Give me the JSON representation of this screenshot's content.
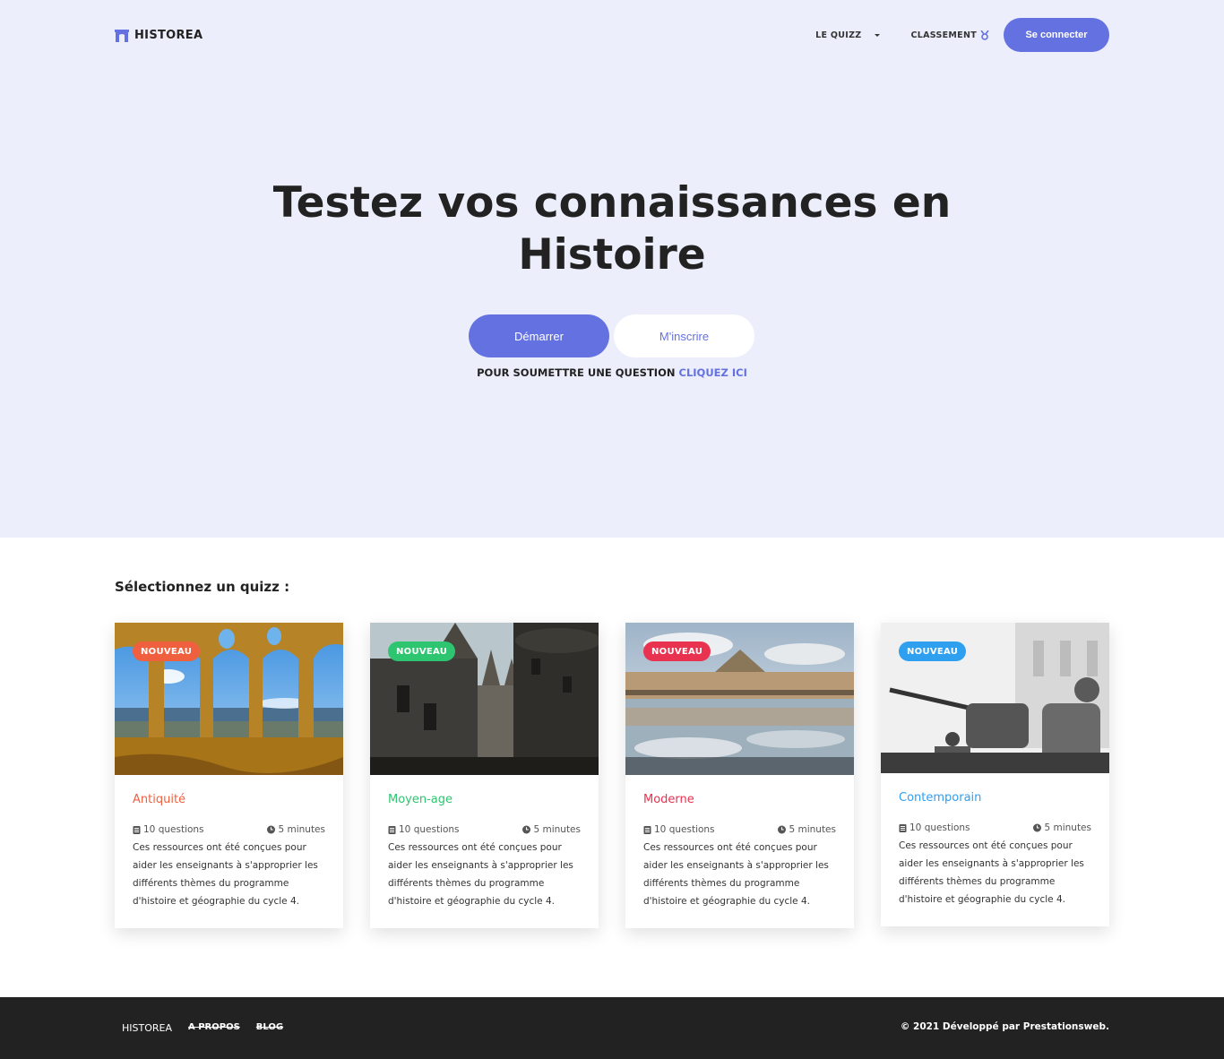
{
  "header": {
    "logo_text": "HISTOREA",
    "nav": {
      "quizz_label": "LE QUIZZ",
      "classement_label": "CLASSEMENT",
      "connect_label": "Se connecter"
    }
  },
  "hero": {
    "title_line1": "Testez vos connaissances en",
    "title_line2": "Histoire",
    "start_label": "Démarrer",
    "register_label": "M'inscrire",
    "submit_text": "POUR SOUMETTRE UNE QUESTION",
    "submit_link": "CLIQUEZ ICI"
  },
  "quiz_section": {
    "title": "Sélectionnez un quizz :",
    "cards": [
      {
        "badge": "NOUVEAU",
        "badge_color": "#f0603f",
        "title": "Antiquité",
        "title_color": "#f0603f",
        "questions": "10 questions",
        "duration": "5 minutes",
        "description": "Ces ressources ont été conçues pour aider les enseignants à s'approprier les différents thèmes du programme d'histoire et géographie du cycle 4."
      },
      {
        "badge": "NOUVEAU",
        "badge_color": "#2dc56f",
        "title": "Moyen-age",
        "title_color": "#2dc56f",
        "questions": "10 questions",
        "duration": "5 minutes",
        "description": "Ces ressources ont été conçues pour aider les enseignants à s'approprier les différents thèmes du programme d'histoire et géographie du cycle 4."
      },
      {
        "badge": "NOUVEAU",
        "badge_color": "#e8324f",
        "title": "Moderne",
        "title_color": "#e8324f",
        "questions": "10 questions",
        "duration": "5 minutes",
        "description": "Ces ressources ont été conçues pour aider les enseignants à s'approprier les différents thèmes du programme d'histoire et géographie du cycle 4."
      },
      {
        "badge": "NOUVEAU",
        "badge_color": "#2f9ff0",
        "title": "Contemporain",
        "title_color": "#2f9ff0",
        "questions": "10 questions",
        "duration": "5 minutes",
        "description": "Ces ressources ont été conçues pour aider les enseignants à s'approprier les différents thèmes du programme d'histoire et géographie du cycle 4."
      }
    ]
  },
  "footer": {
    "links": [
      "HISTOREA",
      "A PROPOS",
      "BLOG"
    ],
    "copyright": "© 2021 Développé par Prestationsweb."
  },
  "colors": {
    "accent": "#6472e1",
    "hero_bg": "#eceefb",
    "footer_bg": "#222222"
  }
}
